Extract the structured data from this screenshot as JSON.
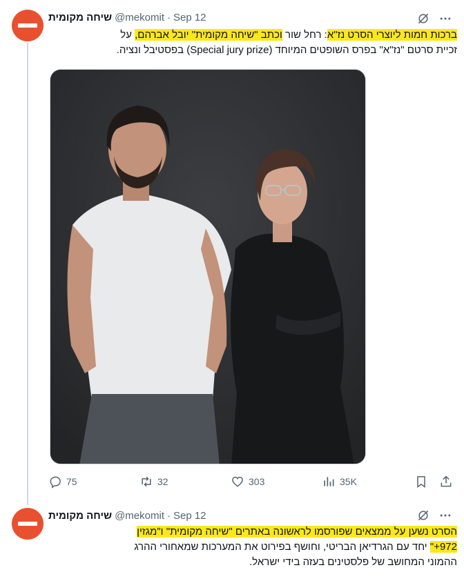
{
  "thread": {
    "tweets": [
      {
        "author_name": "שיחה מקומית",
        "handle": "@mekomit",
        "separator": "·",
        "date": "Sep 12",
        "text_line1_pre": "",
        "text_line1_hl1": "ברכות חמות ליוצרי הסרט נז\"א",
        "text_line1_mid": ": רחל שור ",
        "text_line1_hl2": "וכתב \"שיחה מקומית\" יובל אברהם,",
        "text_line1_post": " על",
        "text_line2": "זכיית סרטם \"נז\"א\" בפרס השופטים המיוחד (Special jury prize) בפסטיבל ונציה.",
        "media_alt": "photo",
        "stats": {
          "replies": "75",
          "retweets": "32",
          "likes": "303",
          "views": "35K"
        }
      },
      {
        "author_name": "שיחה מקומית",
        "handle": "@mekomit",
        "separator": "·",
        "date": "Sep 12",
        "text_line1_hl": "הסרט נשען על ממצאים שפורסמו לראשונה באתרים \"שיחה מקומית\" ו\"מגזין",
        "text_line2_hl": "972+\"",
        "text_line2_post": " יחד עם הגרדיאן הבריטי, וחושף בפירוט את המערכות שמאחורי ההרג",
        "text_line3": "ההמוני המחושב של פלסטינים בעזה בידי ישראל."
      }
    ]
  },
  "colors": {
    "avatar": "#e9502f",
    "highlight": "#fde71c",
    "secondary_text": "#536471",
    "thread_line": "#cfd9de"
  },
  "icons": [
    "grok-icon",
    "more-icon",
    "reply-icon",
    "retweet-icon",
    "like-icon",
    "views-icon",
    "bookmark-icon",
    "share-icon"
  ]
}
